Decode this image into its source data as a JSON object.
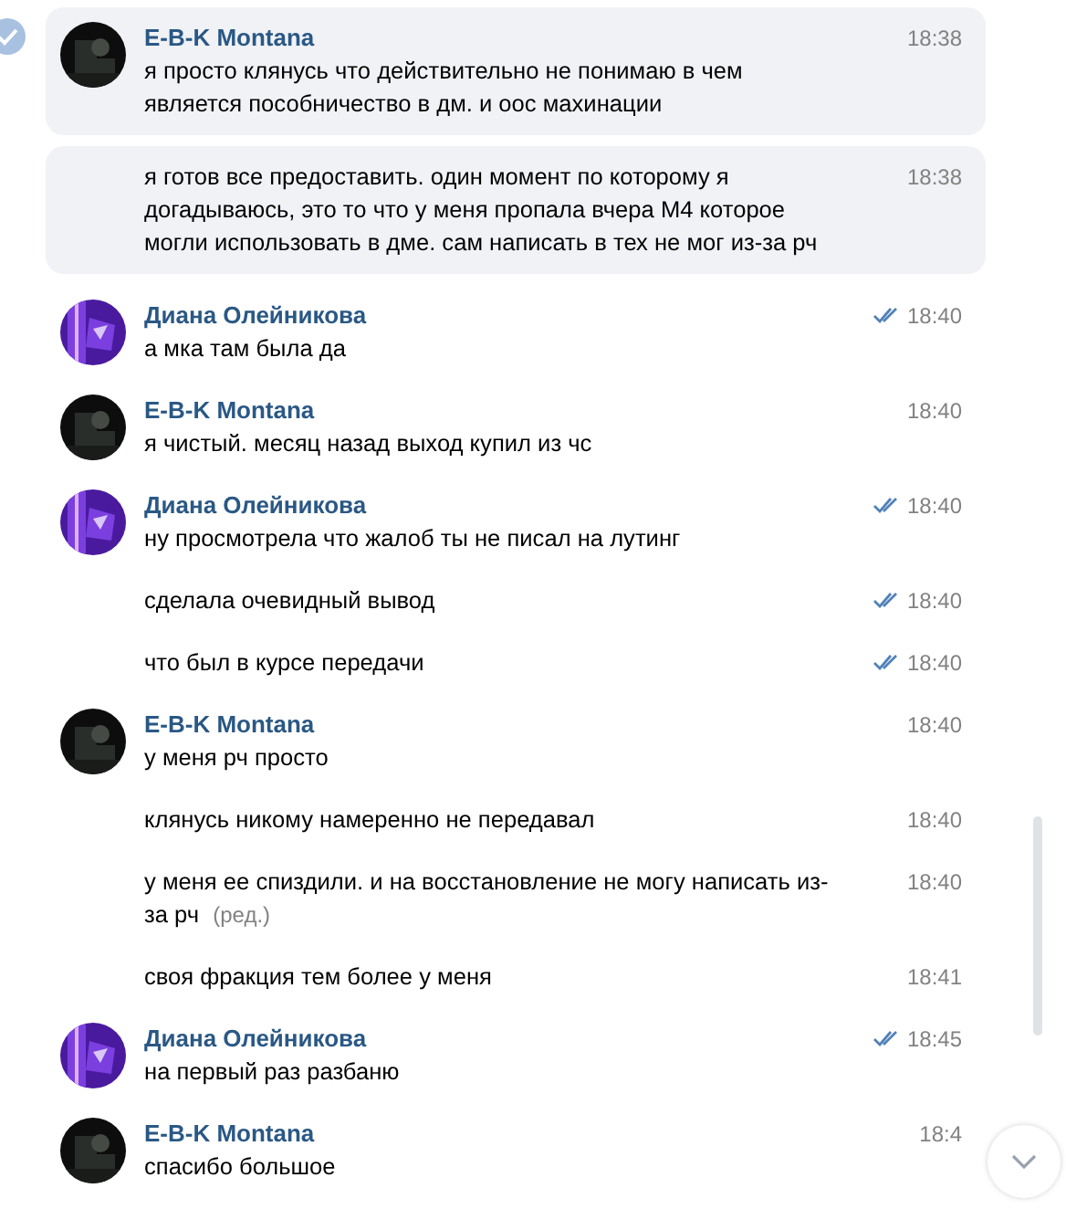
{
  "messages": [
    {
      "author": "E-B-K Montana",
      "text": "я просто клянусь что действительно не понимаю в чем является пособничество в дм. и оос махинации",
      "time": "18:38",
      "read": false,
      "selected": true,
      "checkmark": true
    },
    {
      "text": "я готов все предоставить. один момент по которому я догадываюсь, это то что у меня пропала вчера М4 которое могли использовать в дме. сам написать в тех не мог из-за рч",
      "time": "18:38",
      "read": false,
      "selected": true,
      "checkmark": false
    },
    {
      "author": "Диана Олейникова",
      "text": "а мка там была да",
      "time": "18:40",
      "read": true,
      "selected": false,
      "checkmark": false
    },
    {
      "author": "E-B-K Montana",
      "text": "я чистый. месяц назад выход купил из чс",
      "time": "18:40",
      "read": false,
      "selected": false,
      "checkmark": false
    },
    {
      "author": "Диана Олейникова",
      "text": "ну просмотрела что жалоб ты не писал на лутинг",
      "time": "18:40",
      "read": true,
      "selected": false,
      "checkmark": false
    },
    {
      "text": "сделала очевидный вывод",
      "time": "18:40",
      "read": true,
      "selected": false,
      "checkmark": false
    },
    {
      "text": "что был в курсе передачи",
      "time": "18:40",
      "read": true,
      "selected": false,
      "checkmark": false
    },
    {
      "author": "E-B-K Montana",
      "text": "у меня рч просто",
      "time": "18:40",
      "read": false,
      "selected": false,
      "checkmark": false
    },
    {
      "text": "клянусь никому намеренно не передавал",
      "time": "18:40",
      "read": false,
      "selected": false,
      "checkmark": false
    },
    {
      "text": "у меня ее спиздили. и на восстановление не могу написать из-за рч",
      "edited_label": "(ред.)",
      "time": "18:40",
      "read": false,
      "selected": false,
      "checkmark": false
    },
    {
      "text": "своя фракция тем более у меня",
      "time": "18:41",
      "read": false,
      "selected": false,
      "checkmark": false
    },
    {
      "author": "Диана Олейникова",
      "text": "на первый раз разбаню",
      "time": "18:45",
      "read": true,
      "selected": false,
      "checkmark": false
    },
    {
      "author": "E-B-K Montana",
      "text": "спасибо большое",
      "time": "18:4",
      "read": false,
      "selected": false,
      "checkmark": false
    }
  ]
}
